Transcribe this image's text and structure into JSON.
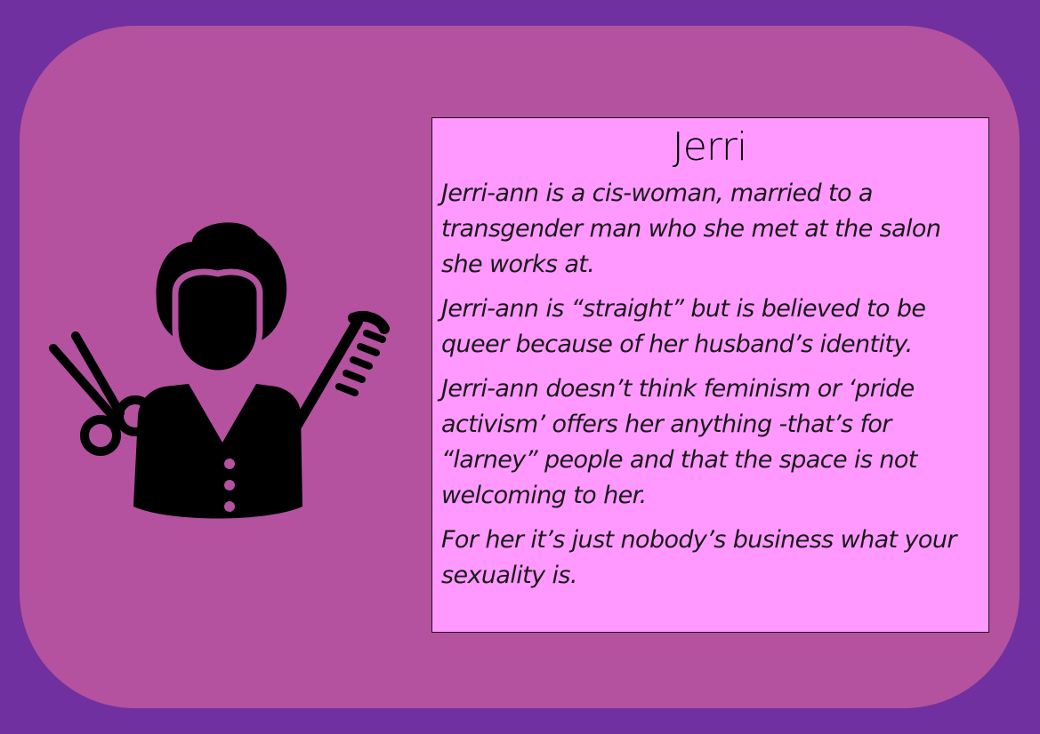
{
  "colors": {
    "background": "#7030a0",
    "card": "#b4529f",
    "info_box": "#ff99ff",
    "icon": "#000000"
  },
  "illustration": {
    "icon": "hairdresser-icon"
  },
  "profile": {
    "title": "Jerri",
    "paragraphs": [
      "Jerri-ann is a cis-woman, married to a transgender man who she met at the salon she works at.",
      "Jerri-ann is “straight” but is believed to be queer because of her husband’s identity.",
      "Jerri-ann doesn’t think feminism or ‘pride activism’ offers her anything -that’s for “larney” people and that the space is not welcoming to her.",
      "For her it’s just nobody’s business what your sexuality is."
    ]
  }
}
